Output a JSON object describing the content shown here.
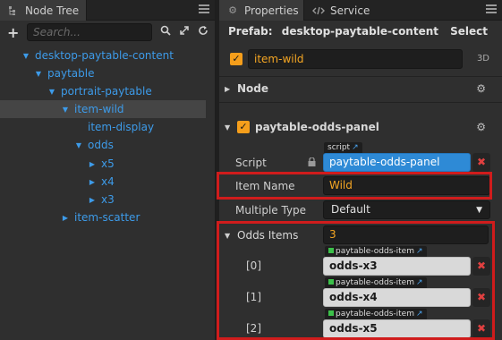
{
  "node_tree": {
    "tab_label": "Node Tree",
    "search_placeholder": "Search...",
    "items": [
      {
        "label": "desktop-paytable-content",
        "arrow": "down"
      },
      {
        "label": "paytable",
        "arrow": "down"
      },
      {
        "label": "portrait-paytable",
        "arrow": "down"
      },
      {
        "label": "item-wild",
        "arrow": "down",
        "selected": true
      },
      {
        "label": "item-display",
        "arrow": "none"
      },
      {
        "label": "odds",
        "arrow": "down"
      },
      {
        "label": "x5",
        "arrow": "right"
      },
      {
        "label": "x4",
        "arrow": "right"
      },
      {
        "label": "x3",
        "arrow": "right"
      },
      {
        "label": "item-scatter",
        "arrow": "right"
      }
    ]
  },
  "properties": {
    "tab_label": "Properties",
    "service_tab_label": "Service",
    "prefab_label": "Prefab:",
    "prefab_name": "desktop-paytable-content",
    "prefab_select": "Select",
    "node_name": "item-wild",
    "node_3d": "3D",
    "node_section": "Node",
    "component_section": "paytable-odds-panel",
    "script_label": "Script",
    "script_tag": "script",
    "script_value": "paytable-odds-panel",
    "item_name_label": "Item Name",
    "item_name_value": "Wild",
    "multiple_type_label": "Multiple Type",
    "multiple_type_value": "Default",
    "odds_items_label": "Odds Items",
    "odds_items_count": "3",
    "odds_items": [
      {
        "index": "[0]",
        "tag": "paytable-odds-item",
        "value": "odds-x3"
      },
      {
        "index": "[1]",
        "tag": "paytable-odds-item",
        "value": "odds-x4"
      },
      {
        "index": "[2]",
        "tag": "paytable-odds-item",
        "value": "odds-x5"
      }
    ]
  },
  "colors": {
    "tree_text": "#3d9be9",
    "highlight_box": "#d01c1c",
    "accent_orange": "#f5a623",
    "remove_red": "#e04040"
  }
}
